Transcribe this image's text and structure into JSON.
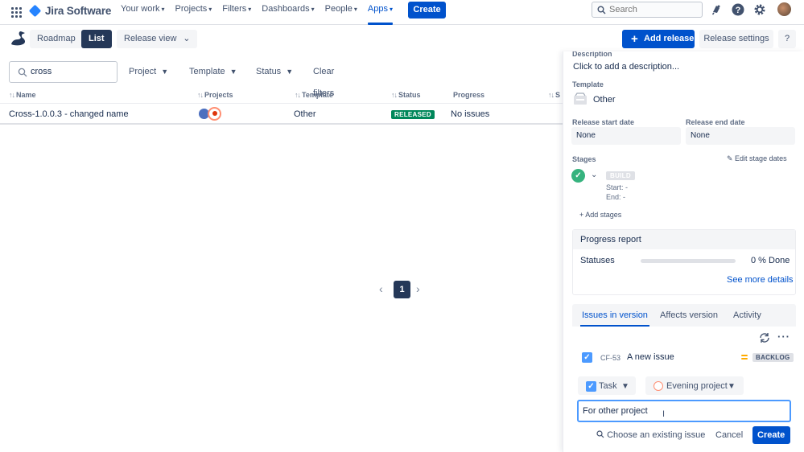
{
  "app": {
    "name": "Jira Software"
  },
  "topnav": {
    "items": [
      {
        "label": "Your work"
      },
      {
        "label": "Projects"
      },
      {
        "label": "Filters"
      },
      {
        "label": "Dashboards"
      },
      {
        "label": "People"
      },
      {
        "label": "Apps",
        "active": true
      }
    ],
    "create_label": "Create",
    "search_placeholder": "Search"
  },
  "toolbar": {
    "roadmap_label": "Roadmap",
    "list_label": "List",
    "release_view_label": "Release view",
    "add_release_label": "Add release",
    "release_settings_label": "Release settings",
    "help_label": "?"
  },
  "filters": {
    "search_value": "cross",
    "project_label": "Project",
    "template_label": "Template",
    "status_label": "Status",
    "clear_label": "Clear filters"
  },
  "table": {
    "headers": [
      "Name",
      "Projects",
      "Template",
      "Status",
      "Progress",
      "S"
    ],
    "rows": [
      {
        "name": "Cross-1.0.0.3 - changed name",
        "template": "Other",
        "status": "RELEASED",
        "progress": "No issues"
      }
    ]
  },
  "pagination": {
    "current": "1"
  },
  "panel": {
    "description_label": "Description",
    "description_placeholder": "Click to add a description...",
    "template_label": "Template",
    "template_value": "Other",
    "start_label": "Release start date",
    "start_value": "None",
    "end_label": "Release end date",
    "end_value": "None",
    "stages_label": "Stages",
    "edit_stage_dates": "Edit stage dates",
    "stage": {
      "name": "BUILD",
      "start": "Start: -",
      "end": "End: -"
    },
    "add_stages": "Add stages",
    "progress": {
      "title": "Progress report",
      "statuses_label": "Statuses",
      "done_fraction": 0,
      "done_text": "0 % Done",
      "see_more": "See more details"
    },
    "tabs": [
      "Issues in version",
      "Affects version",
      "Activity"
    ],
    "issue": {
      "key": "CF-53",
      "summary": "A new issue",
      "status": "BACKLOG"
    },
    "new_issue": {
      "type": "Task",
      "project": "Evening project",
      "summary_value": "For other project",
      "choose_existing": "Choose an existing issue",
      "cancel": "Cancel",
      "create": "Create"
    }
  },
  "colors": {
    "primary": "#0052cc",
    "released": "#00875a",
    "done": "#36b37e",
    "nav_dark": "#253858"
  }
}
